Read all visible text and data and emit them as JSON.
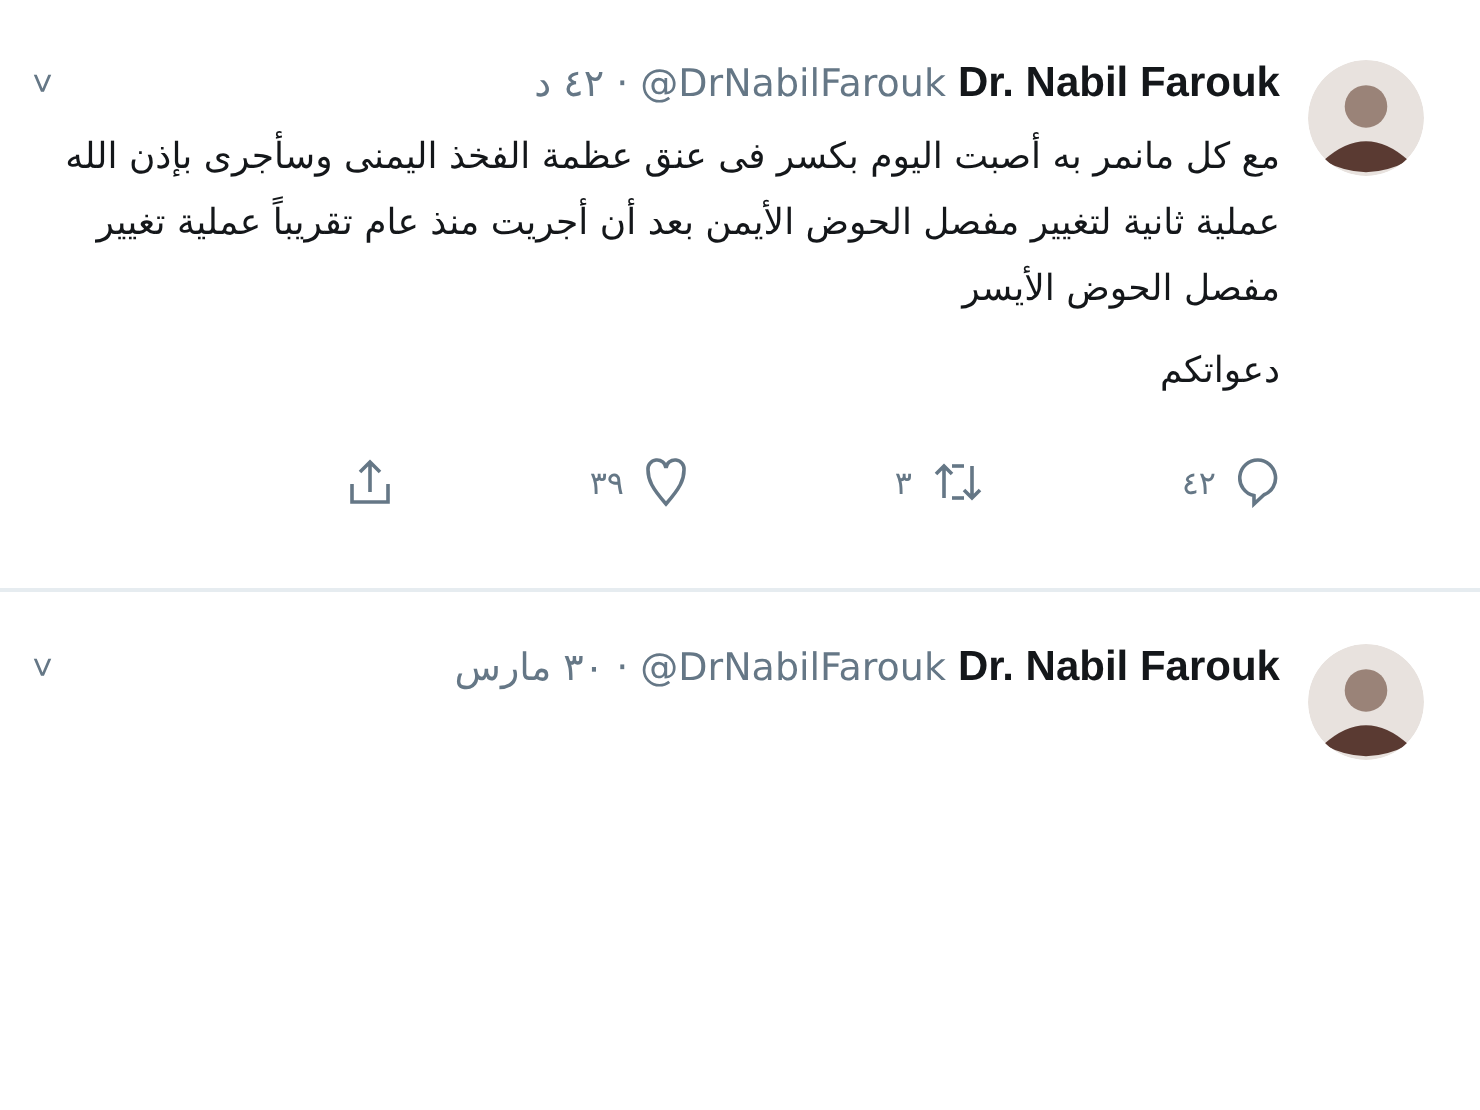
{
  "tweets": [
    {
      "name": "Dr. Nabil Farouk",
      "handle": "@DrNabilFarouk",
      "separator": "·",
      "time": "٤٢ د",
      "caret": "˅",
      "paragraphs": [
        "مع كل مانمر به أصبت اليوم بكسر فى عنق عظمة الفخذ اليمنى وسأجرى بإذن الله عملية ثانية لتغيير مفصل الحوض الأيمن بعد أن أجريت منذ عام تقريباً عملية تغيير مفصل الحوض الأيسر",
        "دعواتكم"
      ],
      "actions": [
        {
          "kind": "reply",
          "count": "٤٢"
        },
        {
          "kind": "retweet",
          "count": "٣"
        },
        {
          "kind": "like",
          "count": "٣٩"
        },
        {
          "kind": "share"
        }
      ]
    },
    {
      "name": "Dr. Nabil Farouk",
      "handle": "@DrNabilFarouk",
      "separator": "·",
      "time": "٣٠ مارس",
      "caret": "˅"
    }
  ]
}
